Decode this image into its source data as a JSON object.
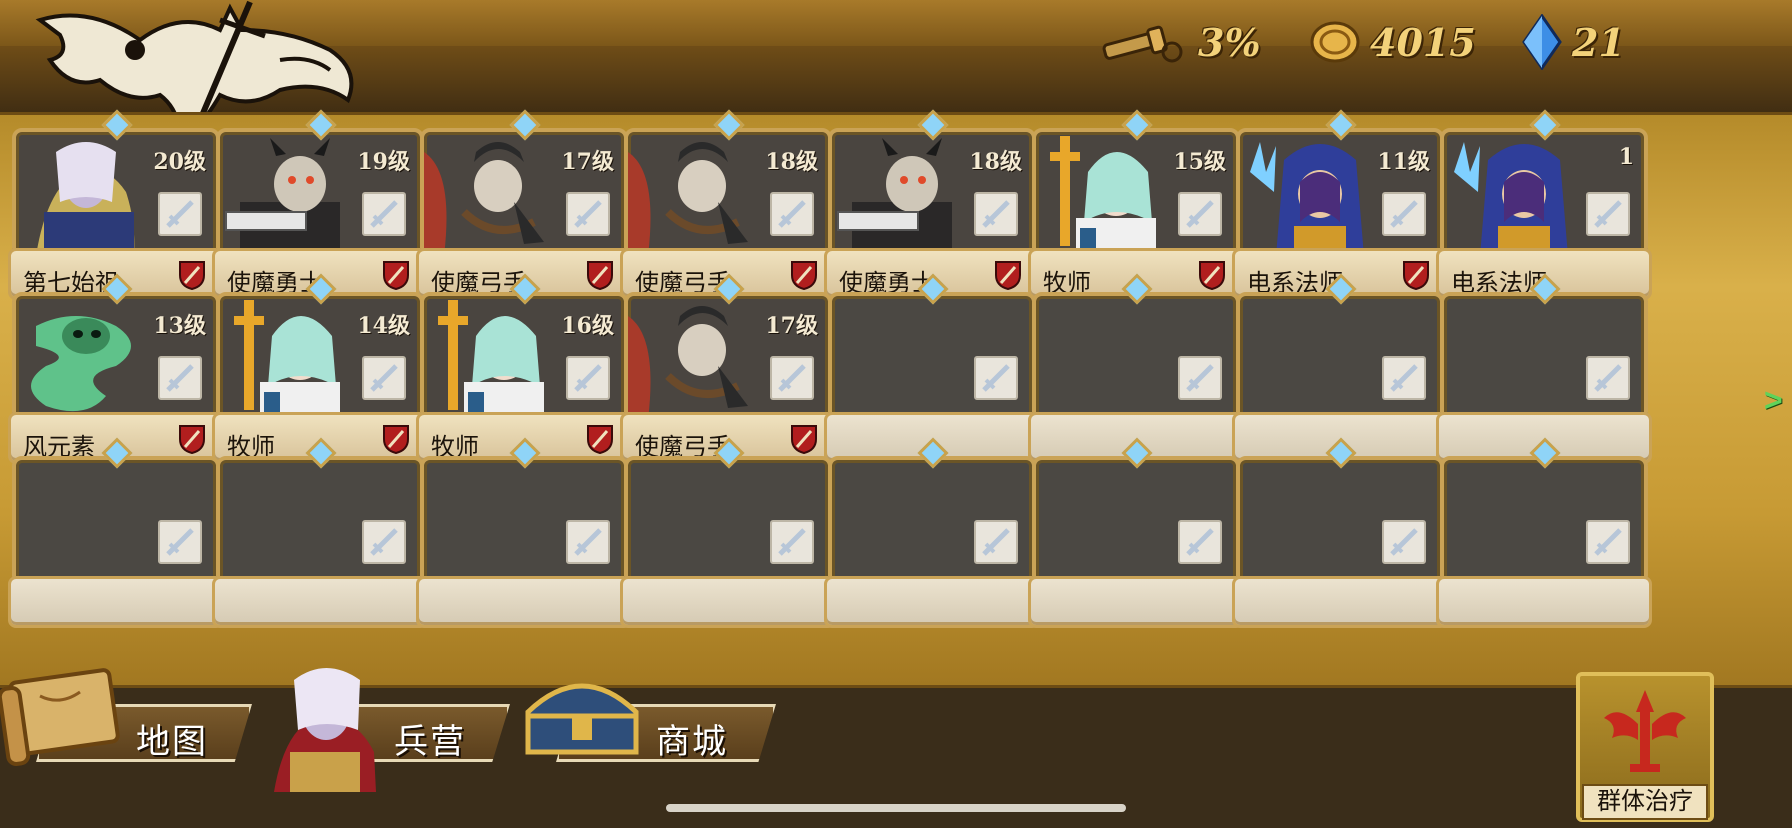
{
  "resources": {
    "scope": {
      "icon": "spyglass-icon",
      "value": "3%"
    },
    "gold": {
      "icon": "gold-coin-icon",
      "value": "4015"
    },
    "gems": {
      "icon": "blue-crystal-icon",
      "value": "21"
    }
  },
  "roster": {
    "rows": [
      [
        {
          "name": "第七始祖",
          "level": "20级",
          "portrait": "vampire-lord"
        },
        {
          "name": "使魔勇士",
          "level": "19级",
          "portrait": "demon-warrior"
        },
        {
          "name": "使魔弓手",
          "level": "17级",
          "portrait": "demon-archer"
        },
        {
          "name": "使魔弓手",
          "level": "18级",
          "portrait": "demon-archer"
        },
        {
          "name": "使魔勇士",
          "level": "18级",
          "portrait": "demon-warrior"
        },
        {
          "name": "牧师",
          "level": "15级",
          "portrait": "priest"
        },
        {
          "name": "电系法师",
          "level": "11级",
          "portrait": "electric-mage"
        },
        {
          "name": "电系法师",
          "level": "1",
          "portrait": "electric-mage"
        }
      ],
      [
        {
          "name": "风元素",
          "level": "13级",
          "portrait": "wind-elemental"
        },
        {
          "name": "牧师",
          "level": "14级",
          "portrait": "priest"
        },
        {
          "name": "牧师",
          "level": "16级",
          "portrait": "priest"
        },
        {
          "name": "使魔弓手",
          "level": "17级",
          "portrait": "demon-archer"
        },
        null,
        null,
        null,
        null
      ],
      [
        null,
        null,
        null,
        null,
        null,
        null,
        null,
        null
      ]
    ]
  },
  "nav": {
    "map": "地图",
    "barracks": "兵营",
    "shop": "商城"
  },
  "skill": {
    "label": "群体治疗"
  },
  "colors": {
    "panel_gold": "#d9b04a",
    "frame": "#caa356",
    "level_text": "#f4ead2",
    "resource_text": "#f3d27a"
  }
}
